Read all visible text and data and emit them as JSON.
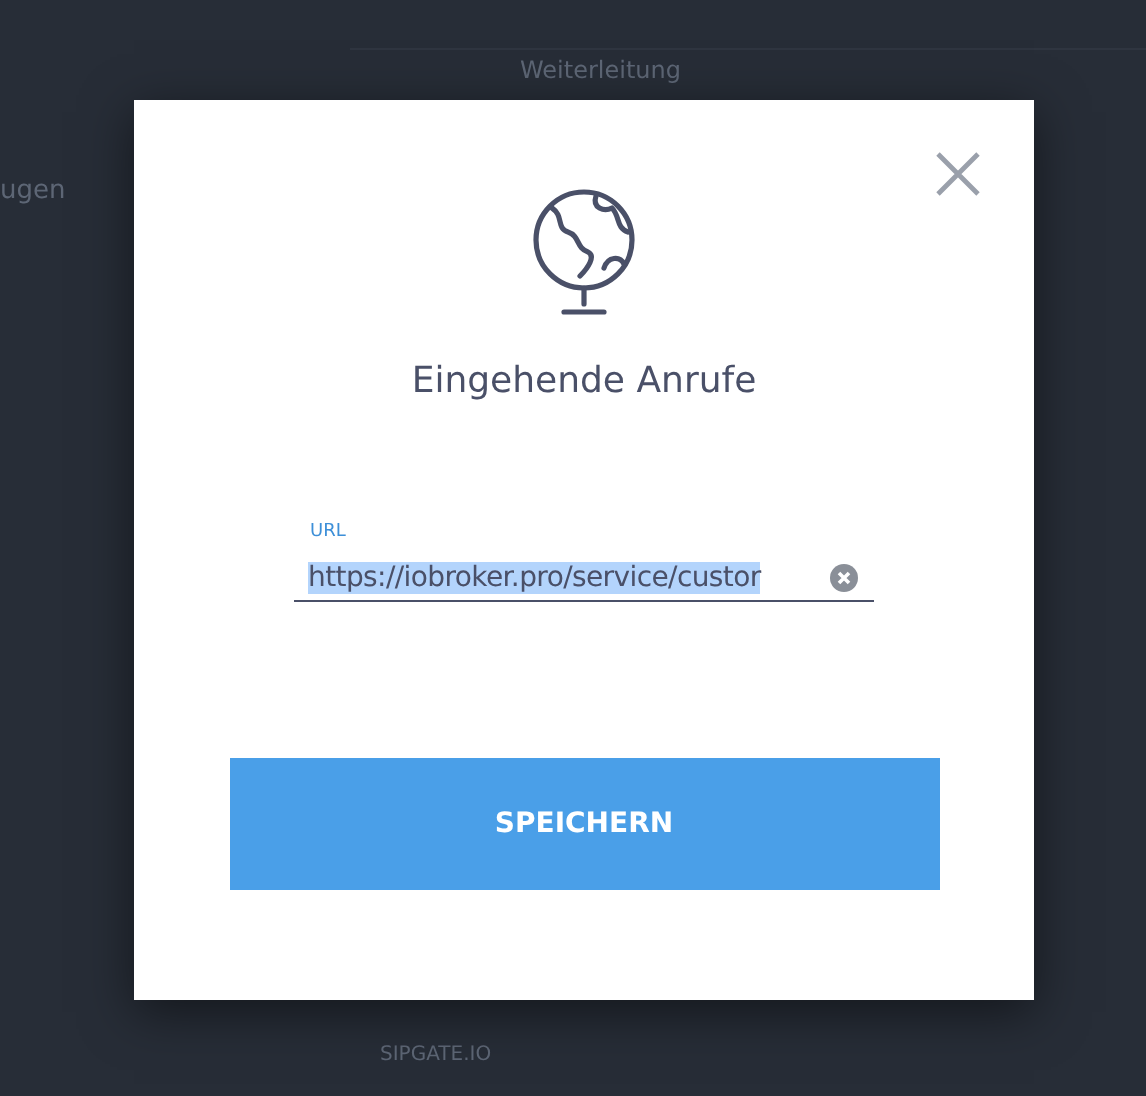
{
  "background": {
    "heading": "Weiterleitung",
    "side_label": "ugen",
    "footer_label": "SIPGATE.IO"
  },
  "dialog": {
    "title": "Eingehende Anrufe",
    "url_field": {
      "label": "URL",
      "value": "https://iobroker.pro/service/custor",
      "text_selected": true
    },
    "save_button": "SPEICHERN"
  }
}
